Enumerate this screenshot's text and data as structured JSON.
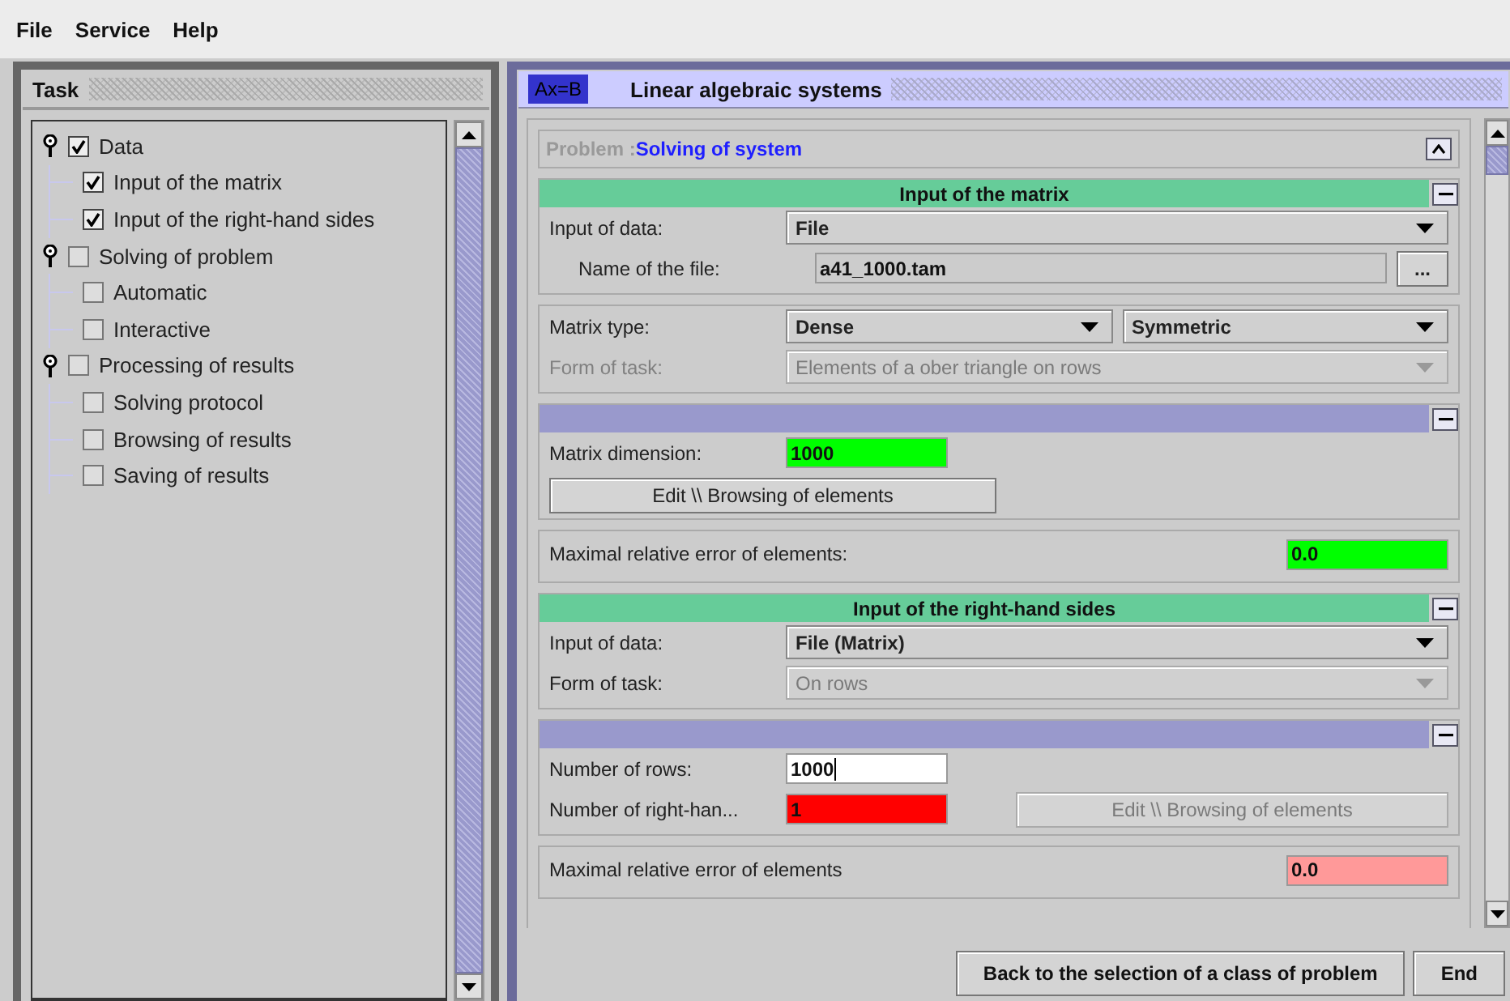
{
  "menu": [
    "File",
    "Service",
    "Help"
  ],
  "task_panel": {
    "title": "Task",
    "tree": [
      {
        "label": "Data",
        "checked": true,
        "expanded": true,
        "children": [
          {
            "label": "Input of the matrix",
            "checked": true
          },
          {
            "label": "Input of the right-hand sides",
            "checked": true
          }
        ]
      },
      {
        "label": "Solving of problem",
        "checked": false,
        "expanded": true,
        "children": [
          {
            "label": "Automatic",
            "checked": false
          },
          {
            "label": "Interactive",
            "checked": false
          }
        ]
      },
      {
        "label": "Processing of results",
        "checked": false,
        "expanded": true,
        "children": [
          {
            "label": "Solving protocol",
            "checked": false
          },
          {
            "label": "Browsing of results",
            "checked": false
          },
          {
            "label": "Saving of results",
            "checked": false
          }
        ]
      }
    ]
  },
  "main_panel": {
    "badge": "Ax=B",
    "title": "Linear algebraic systems",
    "problem": {
      "label": "Problem :",
      "value": "Solving of system"
    },
    "sections": [
      {
        "header": {
          "kind": "green",
          "title": "Input of the matrix"
        },
        "rows": [
          {
            "kind": "form",
            "items": [
              {
                "kind": "label",
                "text": "Input of data:",
                "disabled": false
              },
              {
                "kind": "combo",
                "value": "File",
                "disabled": false
              }
            ]
          },
          {
            "kind": "indent",
            "items": [
              {
                "kind": "label",
                "text": "Name of the file:",
                "disabled": false
              },
              {
                "kind": "path",
                "value": "a41_1000.tam"
              },
              {
                "kind": "small_button",
                "text": "..."
              }
            ]
          }
        ]
      },
      {
        "rows": [
          {
            "kind": "form",
            "items": [
              {
                "kind": "label",
                "text": "Matrix type:",
                "disabled": false
              },
              {
                "kind": "combo",
                "value": "Dense",
                "disabled": false
              },
              {
                "kind": "combo",
                "value": "Symmetric",
                "disabled": false
              }
            ]
          },
          {
            "kind": "form",
            "items": [
              {
                "kind": "label",
                "text": "Form of task:",
                "disabled": true
              },
              {
                "kind": "combo",
                "value": "Elements of a ober triangle on rows",
                "disabled": true
              }
            ]
          }
        ]
      },
      {
        "header": {
          "kind": "purple"
        },
        "rows": [
          {
            "kind": "form",
            "items": [
              {
                "kind": "label",
                "text": "Matrix dimension:",
                "disabled": false
              },
              {
                "kind": "field",
                "value": "1000",
                "color": "#00ff00",
                "focused": false
              }
            ]
          },
          {
            "kind": "form",
            "items": [
              {
                "kind": "button",
                "text": "Edit \\\\ Browsing of elements",
                "disabled": false
              }
            ]
          }
        ]
      },
      {
        "rows": [
          {
            "kind": "spread",
            "items": [
              {
                "kind": "label",
                "text": "Maximal relative error of elements:",
                "disabled": false
              },
              {
                "kind": "field",
                "value": "0.0",
                "color": "#00ff00",
                "focused": false
              }
            ]
          }
        ]
      },
      {
        "header": {
          "kind": "green",
          "title": "Input of the right-hand sides"
        },
        "rows": [
          {
            "kind": "form",
            "items": [
              {
                "kind": "label",
                "text": "Input of data:",
                "disabled": false
              },
              {
                "kind": "combo",
                "value": "File (Matrix)",
                "disabled": false
              }
            ]
          },
          {
            "kind": "form",
            "items": [
              {
                "kind": "label",
                "text": "Form of task:",
                "disabled": false
              },
              {
                "kind": "combo",
                "value": "On rows",
                "disabled": true
              }
            ]
          }
        ]
      },
      {
        "header": {
          "kind": "purple"
        },
        "rows": [
          {
            "kind": "form",
            "items": [
              {
                "kind": "label",
                "text": "Number of rows:",
                "disabled": false
              },
              {
                "kind": "field",
                "value": "1000",
                "color": "#ffffff",
                "focused": true
              }
            ]
          },
          {
            "kind": "form",
            "items": [
              {
                "kind": "label",
                "text": "Number of right-han...",
                "disabled": false
              },
              {
                "kind": "field",
                "value": "1",
                "color": "#ff0000",
                "focused": false
              },
              {
                "kind": "button",
                "text": "Edit \\\\ Browsing of elements",
                "disabled": true
              }
            ]
          }
        ]
      },
      {
        "rows": [
          {
            "kind": "spread",
            "items": [
              {
                "kind": "label",
                "text": "Maximal relative error of elements",
                "disabled": false
              },
              {
                "kind": "field",
                "value": "0.0",
                "color": "#ff9999",
                "focused": false
              }
            ]
          }
        ]
      }
    ]
  },
  "buttons": [
    "Back to the selection of a class of problem",
    "End"
  ]
}
